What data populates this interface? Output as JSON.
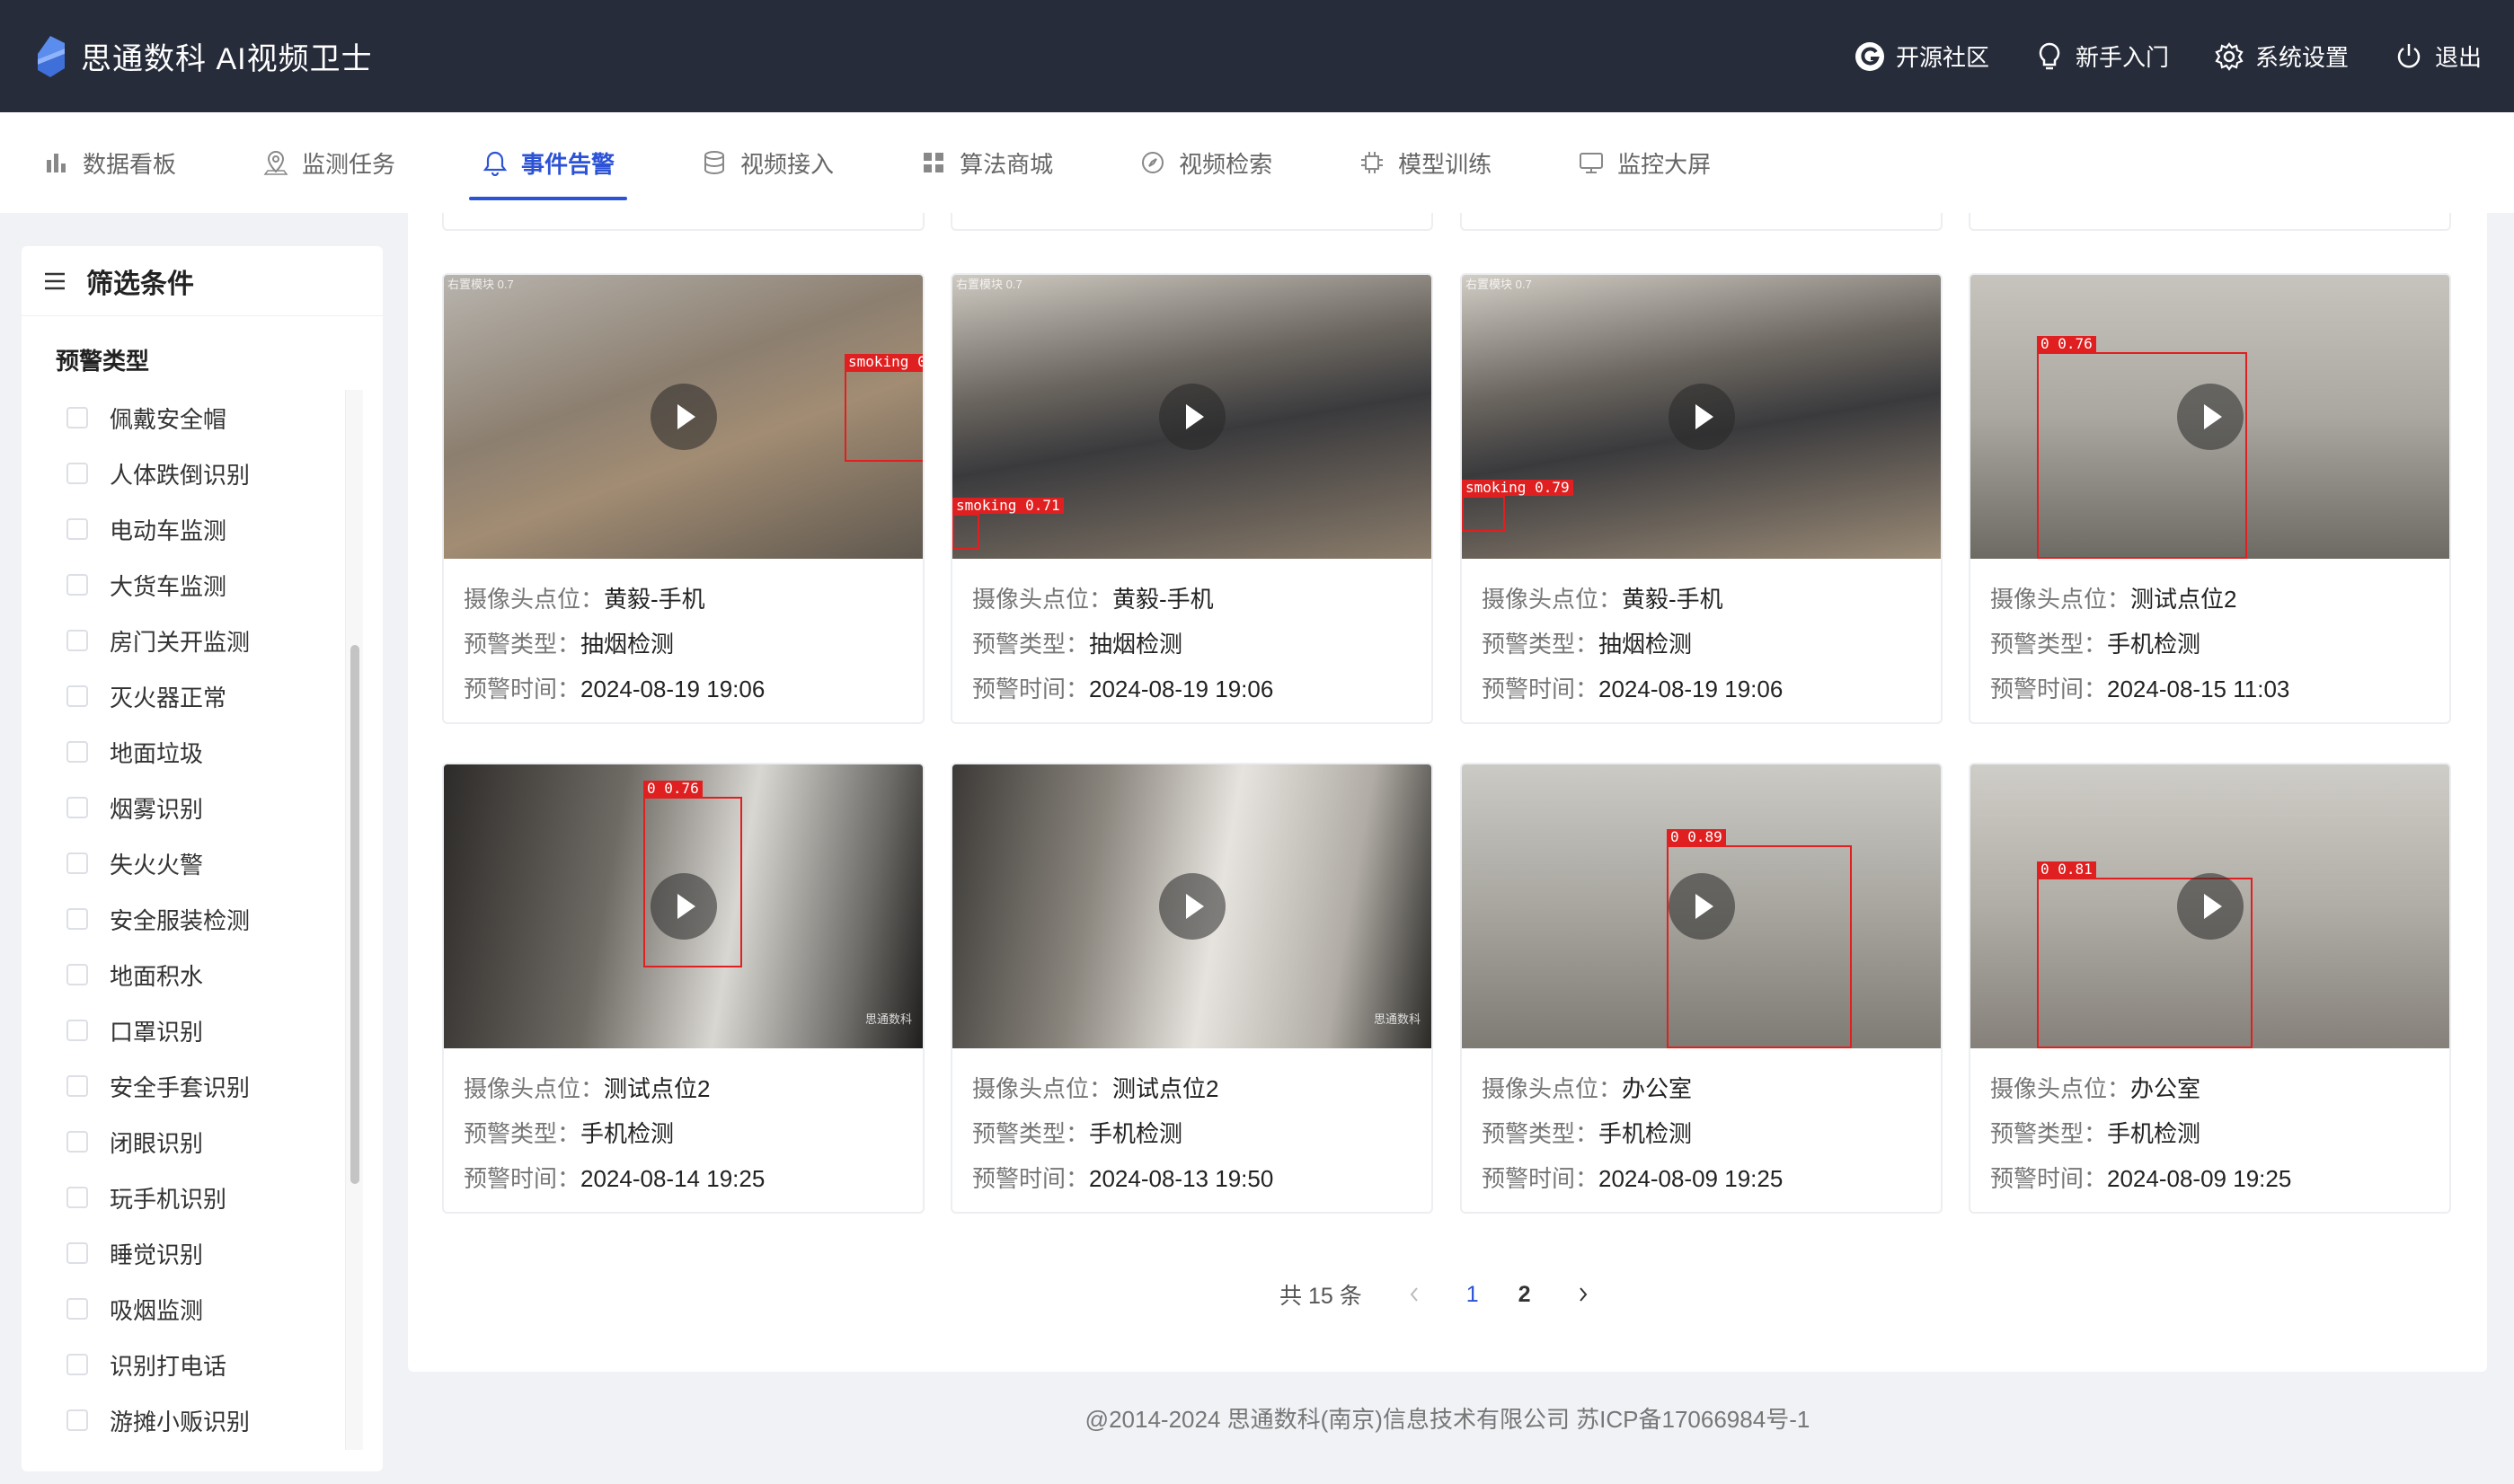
{
  "header": {
    "title": "思通数科 AI视频卫士",
    "actions": [
      {
        "icon": "opensource-logo-icon",
        "label": "开源社区"
      },
      {
        "icon": "lightbulb-icon",
        "label": "新手入门"
      },
      {
        "icon": "gear-icon",
        "label": "系统设置"
      },
      {
        "icon": "power-icon",
        "label": "退出"
      }
    ]
  },
  "nav": {
    "tabs": [
      {
        "icon": "bar-chart-icon",
        "label": "数据看板"
      },
      {
        "icon": "location-pin-icon",
        "label": "监测任务"
      },
      {
        "icon": "bell-icon",
        "label": "事件告警",
        "active": true
      },
      {
        "icon": "database-icon",
        "label": "视频接入"
      },
      {
        "icon": "grid-icon",
        "label": "算法商城"
      },
      {
        "icon": "compass-icon",
        "label": "视频检索"
      },
      {
        "icon": "chip-icon",
        "label": "模型训练"
      },
      {
        "icon": "monitor-icon",
        "label": "监控大屏"
      }
    ]
  },
  "sidebar": {
    "title": "筛选条件",
    "group_title": "预警类型",
    "categories": [
      "佩戴安全帽",
      "人体跌倒识别",
      "电动车监测",
      "大货车监测",
      "房门关开监测",
      "灭火器正常",
      "地面垃圾",
      "烟雾识别",
      "失火火警",
      "安全服装检测",
      "地面积水",
      "口罩识别",
      "安全手套识别",
      "闭眼识别",
      "玩手机识别",
      "睡觉识别",
      "吸烟监测",
      "识别打电话",
      "游摊小贩识别"
    ]
  },
  "labels": {
    "camera": "摄像头点位：",
    "type": "预警类型：",
    "time": "预警时间："
  },
  "alerts": [
    {
      "camera": "黄毅-手机",
      "type": "抽烟检测",
      "time": "2024-08-19 19:06",
      "detection": "smoking 0",
      "watermark": "右置模块 0.7"
    },
    {
      "camera": "黄毅-手机",
      "type": "抽烟检测",
      "time": "2024-08-19 19:06",
      "detection": "smoking 0.71",
      "watermark": "右置模块 0.7"
    },
    {
      "camera": "黄毅-手机",
      "type": "抽烟检测",
      "time": "2024-08-19 19:06",
      "detection": "smoking 0.79",
      "watermark": "右置模块 0.7"
    },
    {
      "camera": "测试点位2",
      "type": "手机检测",
      "time": "2024-08-15 11:03",
      "detection": "0 0.76",
      "watermark": ""
    },
    {
      "camera": "测试点位2",
      "type": "手机检测",
      "time": "2024-08-14 19:25",
      "detection": "0 0.76",
      "watermark": "思通数科"
    },
    {
      "camera": "测试点位2",
      "type": "手机检测",
      "time": "2024-08-13 19:50",
      "detection": "",
      "watermark": "思通数科"
    },
    {
      "camera": "办公室",
      "type": "手机检测",
      "time": "2024-08-09 19:25",
      "detection": "0 0.89",
      "watermark": ""
    },
    {
      "camera": "办公室",
      "type": "手机检测",
      "time": "2024-08-09 19:25",
      "detection": "0 0.81",
      "watermark": ""
    }
  ],
  "pagination": {
    "total_text": "共 15 条",
    "pages": [
      "1",
      "2"
    ],
    "current": "1"
  },
  "footer": {
    "text": "@2014-2024 思通数科(南京)信息技术有限公司 苏ICP备17066984号-1"
  },
  "colors": {
    "header_bg": "#272c3a",
    "accent": "#2c52d6",
    "detection_box": "#e02020"
  }
}
